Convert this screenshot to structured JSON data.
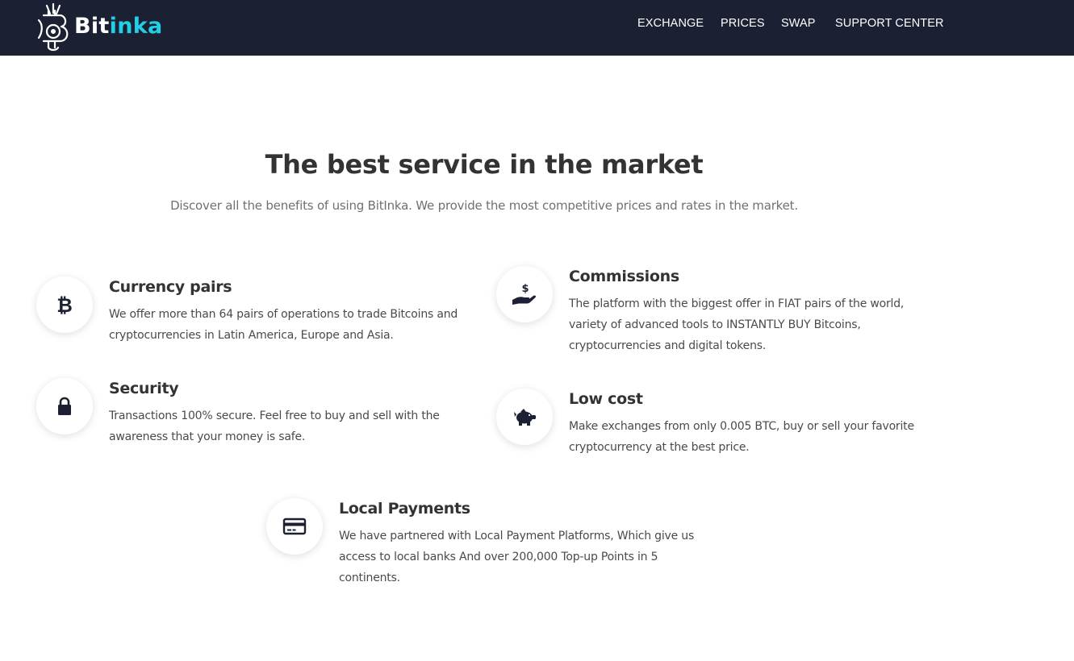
{
  "brand": {
    "name_part1": "Bit",
    "name_part2": "inka"
  },
  "nav": {
    "items": [
      {
        "label": "EXCHANGE"
      },
      {
        "label": "PRICES"
      },
      {
        "label": "SWAP"
      },
      {
        "label": "SUPPORT CENTER"
      }
    ]
  },
  "colors": {
    "navbar_bg": "#1b2032",
    "accent": "#21d0e6",
    "heading": "#333333",
    "body_text": "#4a4a4a",
    "icon": "#1b2032"
  },
  "main": {
    "title": "The best service in the market",
    "subtitle": "Discover all the benefits of using BitInka. We provide the most competitive prices and rates in the market."
  },
  "features": [
    {
      "icon": "bitcoin-icon",
      "title": "Currency pairs",
      "description": "We offer more than 64 pairs of operations to trade Bitcoins and cryptocurrencies in Latin America, Europe and Asia."
    },
    {
      "icon": "hand-dollar-icon",
      "title": "Commissions",
      "description": "The platform with the biggest offer in FIAT pairs of the world, variety of advanced tools to INSTANTLY BUY Bitcoins, cryptocurrencies and digital tokens."
    },
    {
      "icon": "lock-icon",
      "title": "Security",
      "description": "Transactions 100% secure. Feel free to buy and sell with the awareness that your money is safe."
    },
    {
      "icon": "piggy-bank-icon",
      "title": "Low cost",
      "description": "Make exchanges from only 0.005 BTC, buy or sell your favorite cryptocurrency at the best price."
    },
    {
      "icon": "credit-card-icon",
      "title": "Local Payments",
      "description": "We have partnered with Local Payment Platforms, Which give us access to local banks And over 200,000 Top-up Points in 5 continents."
    }
  ]
}
